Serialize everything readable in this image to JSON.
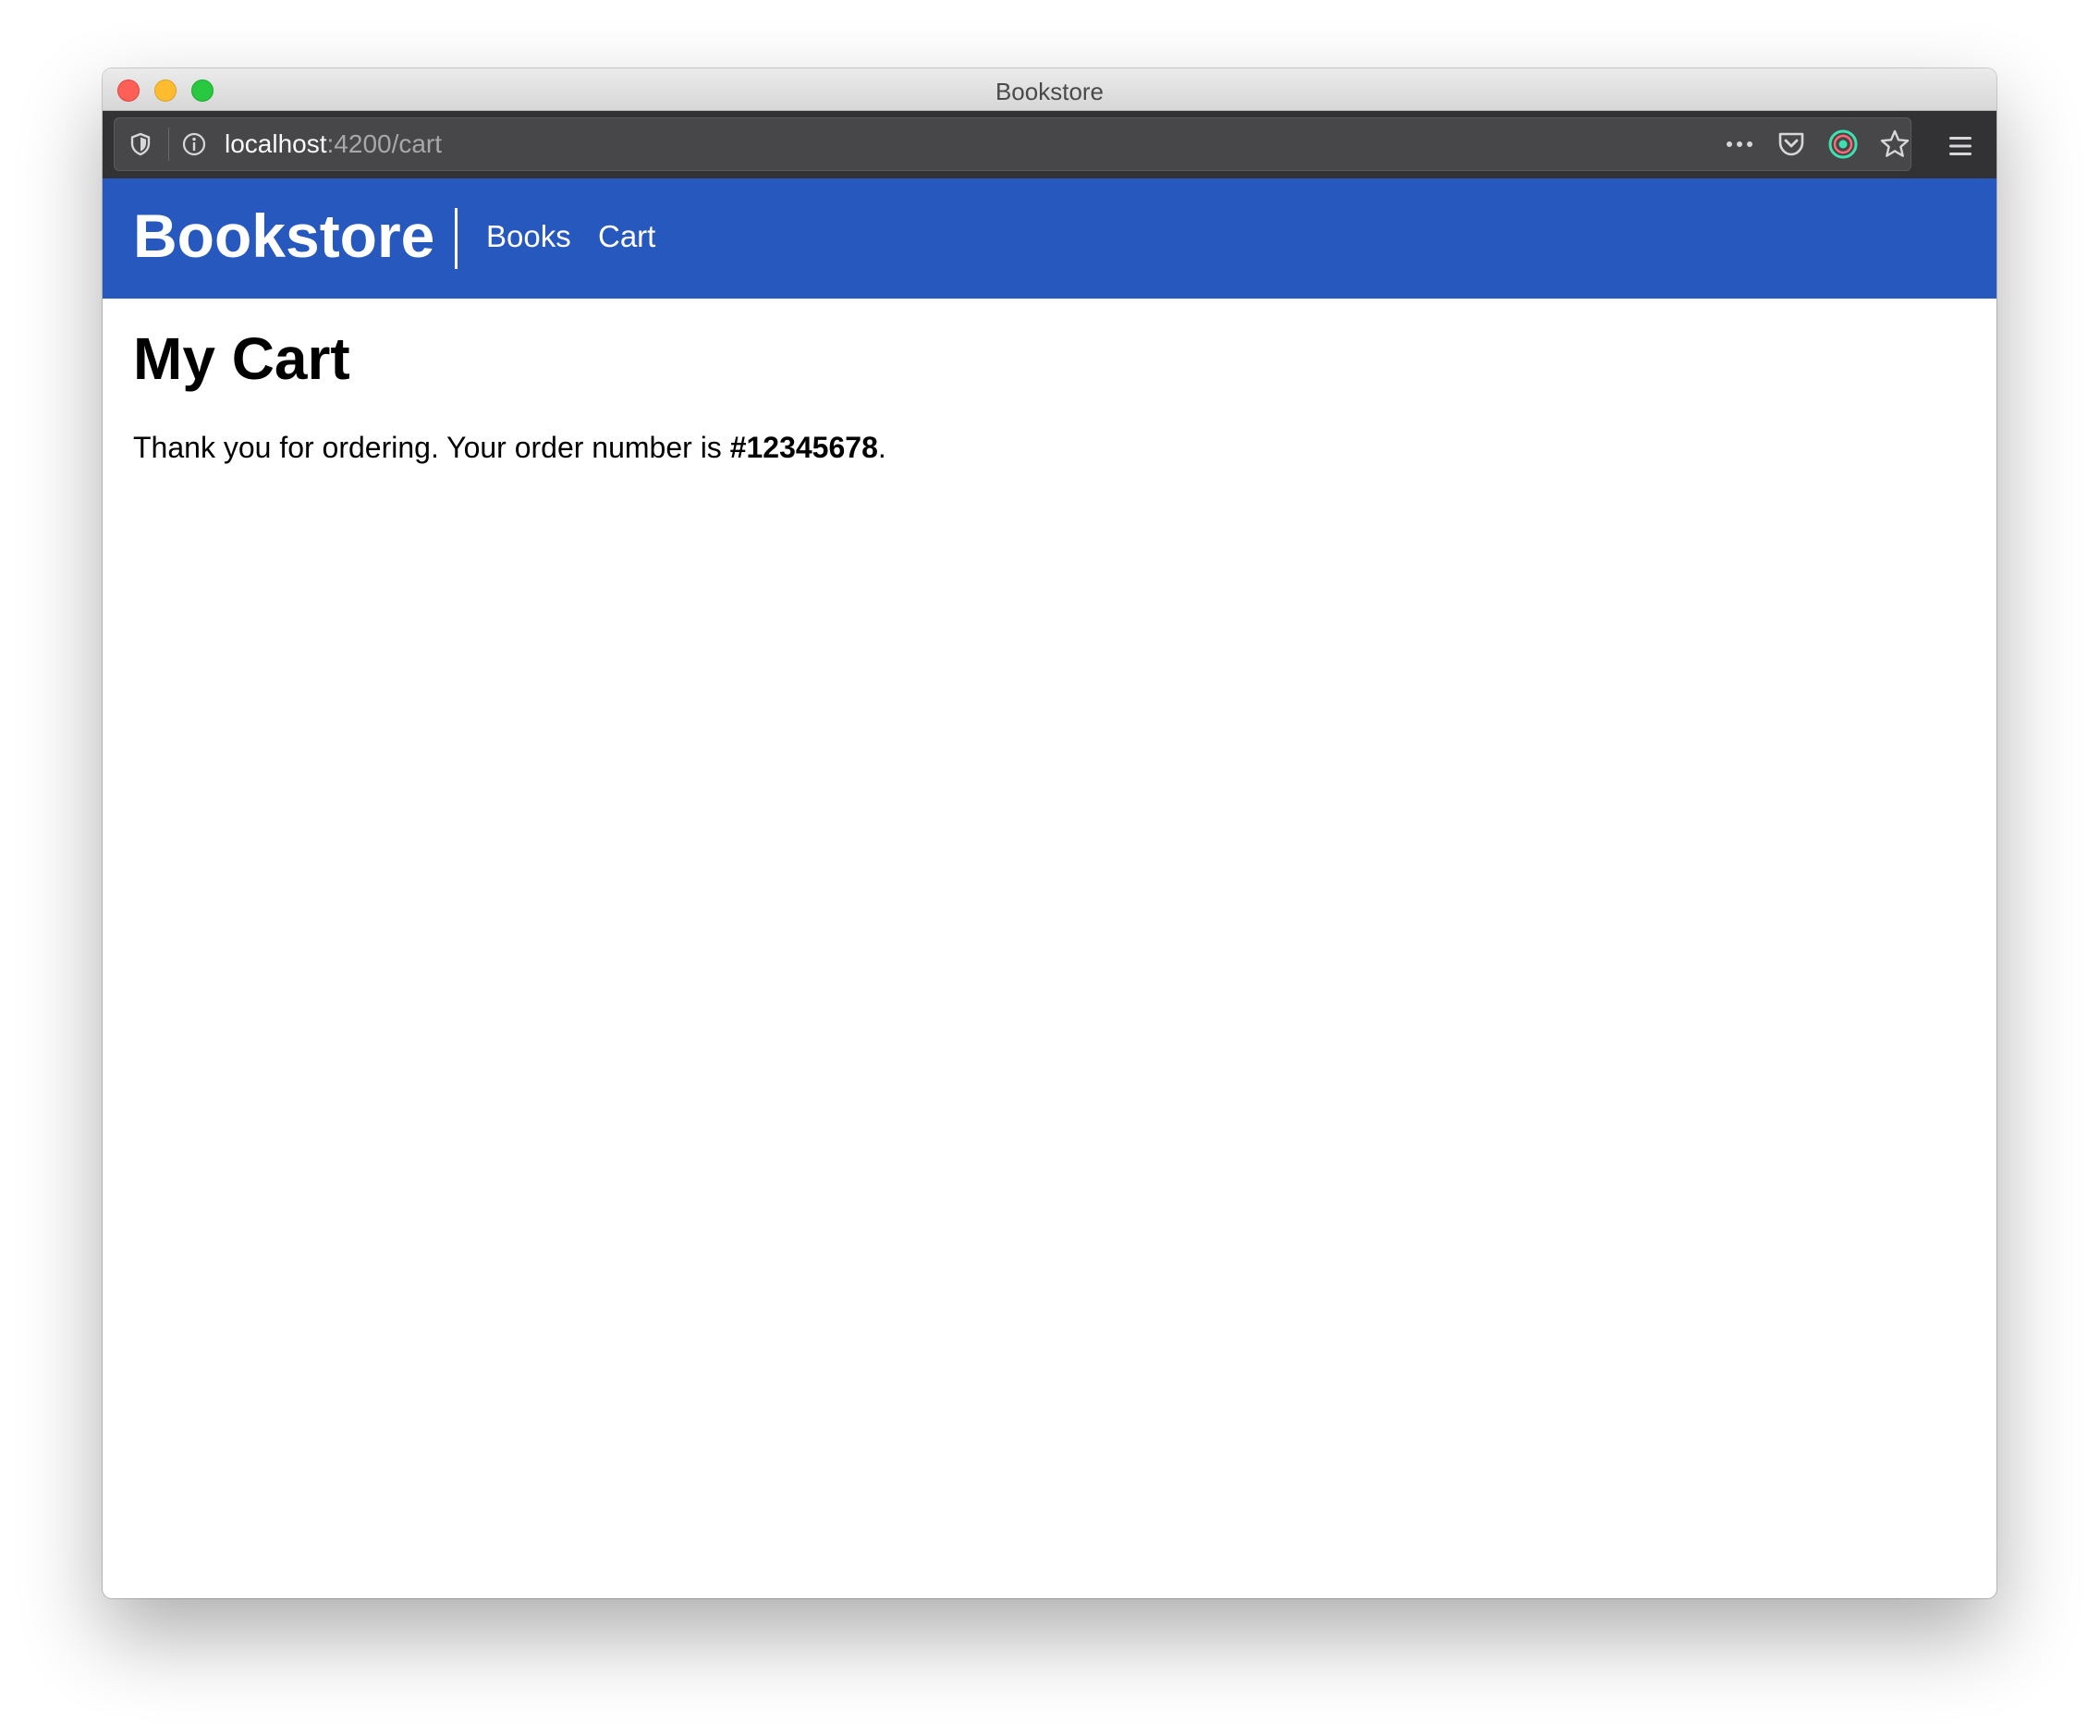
{
  "window": {
    "title": "Bookstore"
  },
  "browser": {
    "url_host": "localhost",
    "url_path": ":4200/cart",
    "icons": [
      "shield-icon",
      "info-icon",
      "more-options-icon",
      "pocket-icon",
      "extension-icon",
      "bookmark-star-icon",
      "hamburger-menu-icon"
    ]
  },
  "navbar": {
    "brand": "Bookstore",
    "links": [
      {
        "label": "Books"
      },
      {
        "label": "Cart"
      }
    ],
    "background_color": "#2758be"
  },
  "main": {
    "title": "My Cart",
    "message_prefix": "Thank you for ordering. Your order number is ",
    "order_number": "#12345678",
    "message_suffix": "."
  }
}
